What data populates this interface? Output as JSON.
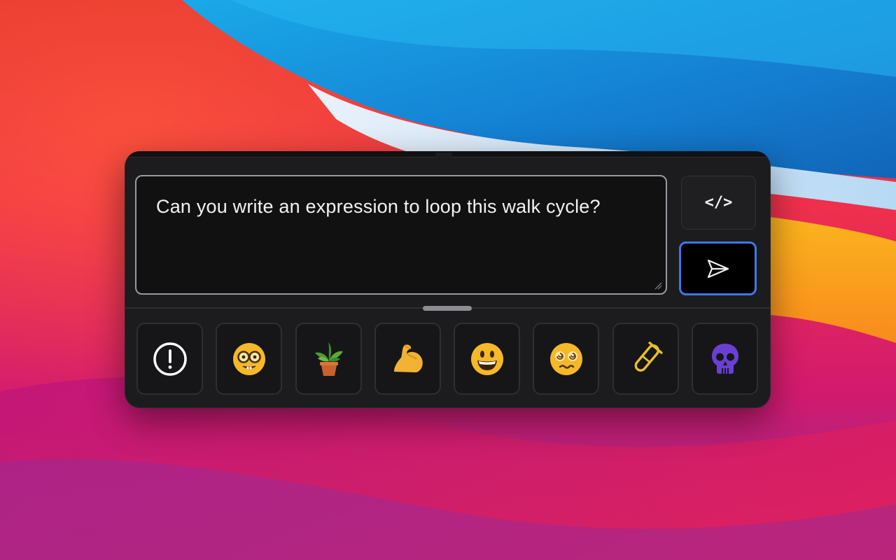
{
  "prompt": {
    "text": "Can you write an expression to loop this walk cycle?"
  },
  "code_button": {
    "label": "</>"
  },
  "send_button": {
    "icon": "send-icon",
    "accent": "#3f76e8"
  },
  "reactions": [
    {
      "icon": "alert-circle-icon",
      "color": "#ffffff"
    },
    {
      "icon": "nerd-face-icon",
      "color": "#f5b829"
    },
    {
      "icon": "potted-plant-icon",
      "color": "#4f9a2f"
    },
    {
      "icon": "flexed-biceps-icon",
      "color": "#f2b233"
    },
    {
      "icon": "grinning-face-icon",
      "color": "#f5b829"
    },
    {
      "icon": "dizzy-face-icon",
      "color": "#f5b829"
    },
    {
      "icon": "test-tube-icon",
      "color": "#e9bf2a"
    },
    {
      "icon": "skull-icon",
      "color": "#6b3fd4"
    }
  ]
}
